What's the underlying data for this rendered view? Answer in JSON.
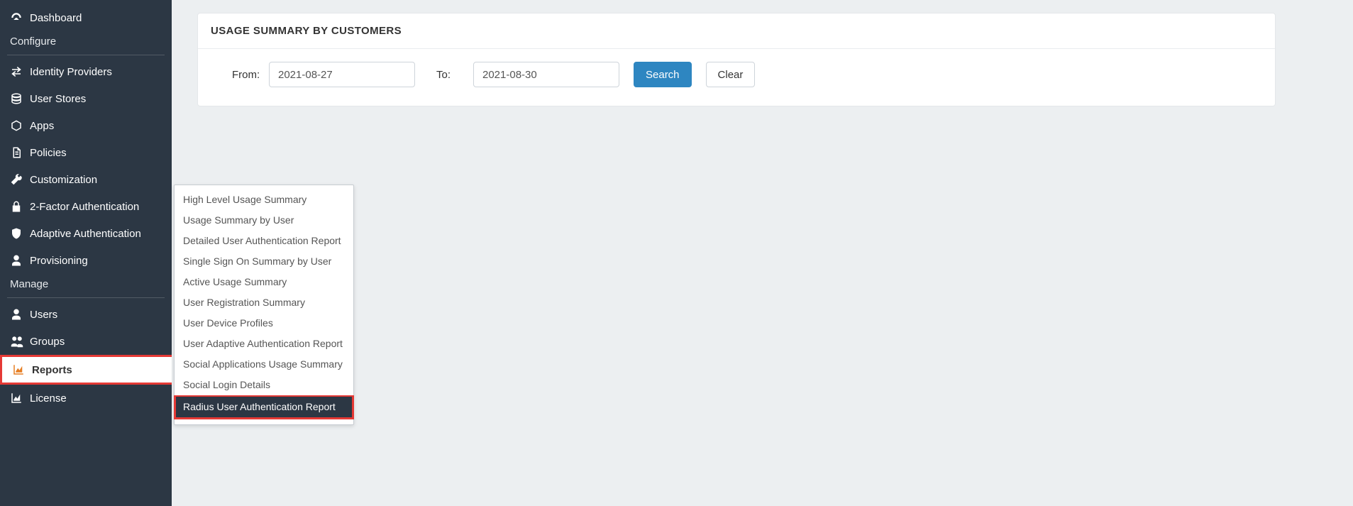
{
  "sidebar": {
    "items": [
      {
        "label": "Dashboard",
        "icon": "dashboard"
      }
    ],
    "sections": [
      {
        "header": "Configure",
        "items": [
          {
            "label": "Identity Providers",
            "icon": "exchange"
          },
          {
            "label": "User Stores",
            "icon": "database"
          },
          {
            "label": "Apps",
            "icon": "cube"
          },
          {
            "label": "Policies",
            "icon": "file"
          },
          {
            "label": "Customization",
            "icon": "wrench"
          },
          {
            "label": "2-Factor Authentication",
            "icon": "lock"
          },
          {
            "label": "Adaptive Authentication",
            "icon": "shield"
          },
          {
            "label": "Provisioning",
            "icon": "user"
          }
        ]
      },
      {
        "header": "Manage",
        "items": [
          {
            "label": "Users",
            "icon": "user"
          },
          {
            "label": "Groups",
            "icon": "users"
          },
          {
            "label": "Reports",
            "icon": "chart",
            "active": true
          },
          {
            "label": "License",
            "icon": "chart"
          }
        ]
      }
    ]
  },
  "panel": {
    "title": "USAGE SUMMARY BY CUSTOMERS",
    "from_label": "From:",
    "to_label": "To:",
    "from_value": "2021-08-27",
    "to_value": "2021-08-30",
    "search_label": "Search",
    "clear_label": "Clear"
  },
  "submenu": {
    "items": [
      "High Level Usage Summary",
      "Usage Summary by User",
      "Detailed User Authentication Report",
      "Single Sign On Summary by User",
      "Active Usage Summary",
      "User Registration Summary",
      "User Device Profiles",
      "User Adaptive Authentication Report",
      "Social Applications Usage Summary",
      "Social Login Details",
      "Radius User Authentication Report"
    ],
    "highlighted_index": 10
  }
}
